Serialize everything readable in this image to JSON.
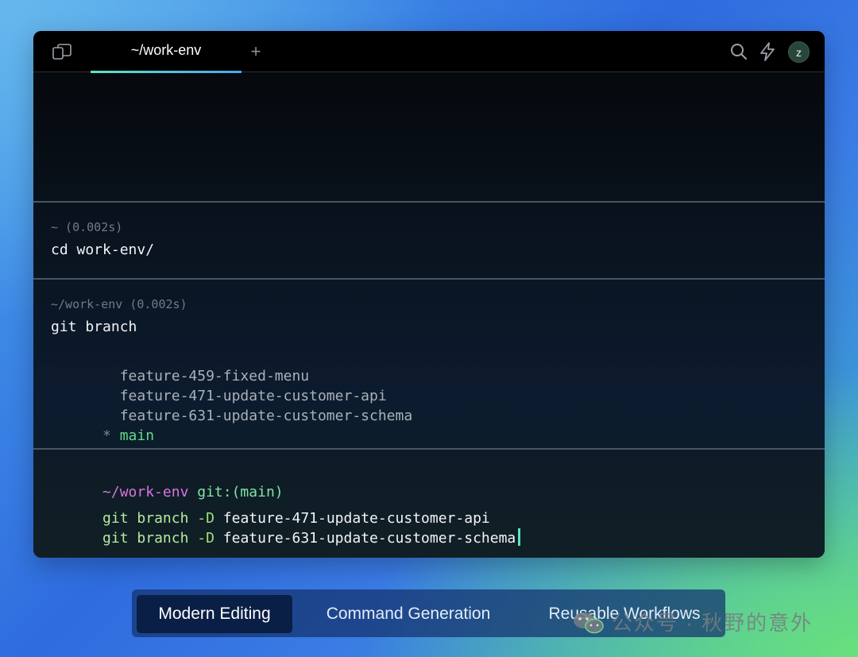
{
  "titlebar": {
    "tab_title": "~/work-env",
    "new_tab_symbol": "+",
    "avatar_initial": "z"
  },
  "blocks": [
    {
      "meta": "~ (0.002s)",
      "command": "cd work-env/"
    },
    {
      "meta": "~/work-env (0.002s)",
      "command": "git branch",
      "output": [
        {
          "prefix": " ",
          "text": "feature-459-fixed-menu"
        },
        {
          "prefix": " ",
          "text": "feature-471-update-customer-api"
        },
        {
          "prefix": " ",
          "text": "feature-631-update-customer-schema"
        },
        {
          "prefix": "*",
          "text": "main"
        }
      ]
    }
  ],
  "active_block": {
    "prompt_path": "~/work-env",
    "prompt_git": "git:(main)",
    "lines": [
      {
        "cmd": "git",
        "sub": "branch",
        "flag": "-D",
        "arg": "feature-471-update-customer-api"
      },
      {
        "cmd": "git",
        "sub": "branch",
        "flag": "-D",
        "arg": "feature-631-update-customer-schema"
      }
    ]
  },
  "feature_tabs": [
    {
      "label": "Modern Editing",
      "active": true
    },
    {
      "label": "Command Generation",
      "active": false
    },
    {
      "label": "Reusable Workflows",
      "active": false
    }
  ],
  "watermark": {
    "text": "公众号 · 秋野的意外"
  },
  "colors": {
    "tab_underline_start": "#5ee3c0",
    "tab_underline_end": "#4aa6f0",
    "prompt_path": "#d773e0",
    "prompt_git": "#7fe6a4",
    "current_branch": "#5fdc86",
    "cursor": "#5ee3c0"
  }
}
